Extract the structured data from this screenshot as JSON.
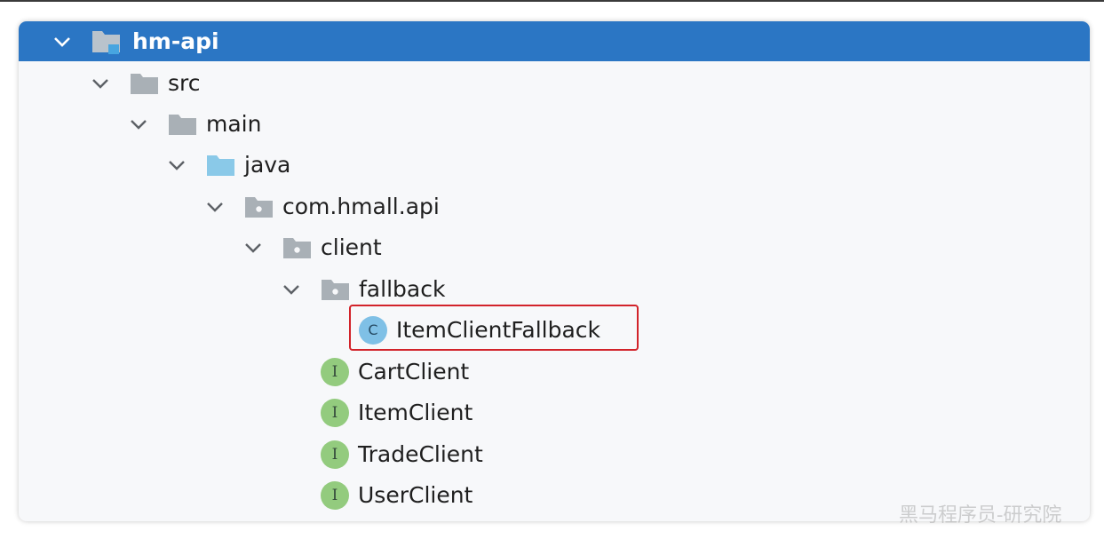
{
  "tree": {
    "root": {
      "label": "hm-api",
      "icon": "module-folder-icon"
    },
    "nodes": [
      {
        "label": "src",
        "icon": "folder-icon"
      },
      {
        "label": "main",
        "icon": "folder-icon"
      },
      {
        "label": "java",
        "icon": "source-folder-icon"
      },
      {
        "label": "com.hmall.api",
        "icon": "package-icon"
      },
      {
        "label": "client",
        "icon": "package-icon"
      },
      {
        "label": "fallback",
        "icon": "package-icon"
      },
      {
        "label": "ItemClientFallback",
        "icon": "class-icon",
        "badge": "C"
      },
      {
        "label": "CartClient",
        "icon": "interface-icon",
        "badge": "I"
      },
      {
        "label": "ItemClient",
        "icon": "interface-icon",
        "badge": "I"
      },
      {
        "label": "TradeClient",
        "icon": "interface-icon",
        "badge": "I"
      },
      {
        "label": "UserClient",
        "icon": "interface-icon",
        "badge": "I"
      }
    ]
  },
  "colors": {
    "selection": "#2b76c4",
    "highlight_border": "#d2232a",
    "class_badge": "#7fc0e6",
    "interface_badge": "#93cb7e",
    "folder": "#a9b0b6",
    "source_folder": "#8ac9e8"
  },
  "watermark": "黑马程序员-研究院"
}
